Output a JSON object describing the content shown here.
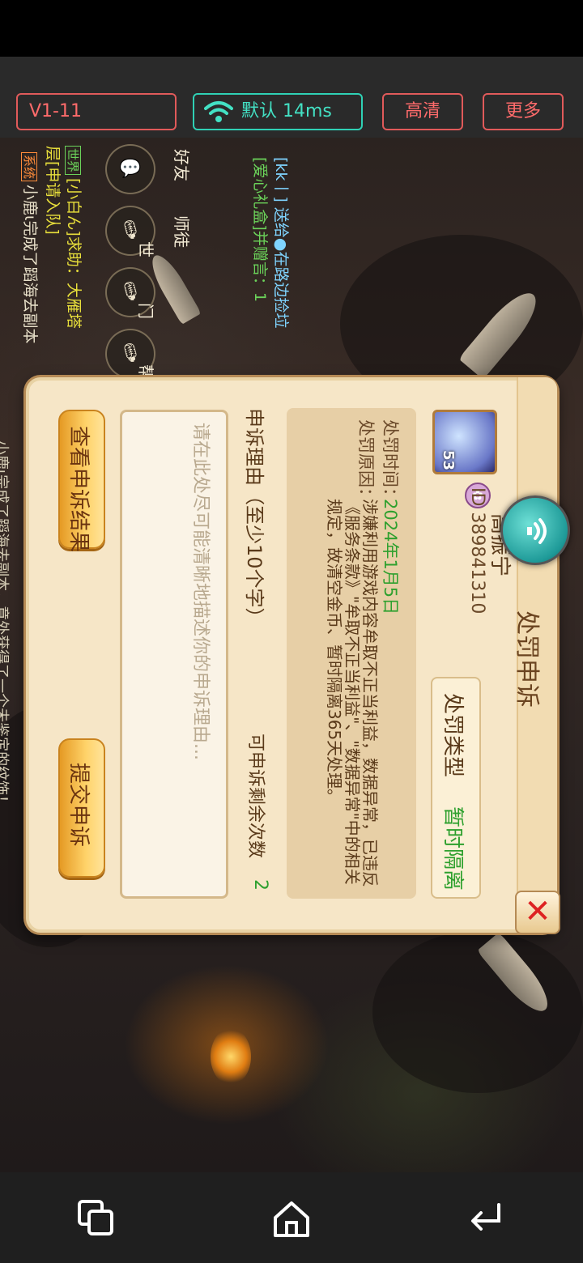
{
  "toolbar": {
    "version": "V1-11",
    "network": "默认 14ms",
    "hd": "高清",
    "more": "更多"
  },
  "game": {
    "chat": {
      "system_tag": "系统",
      "system_line": "小鹿ι完成了蹈海去副本",
      "world_tag": "世界",
      "world_line": "[小白ん]求助：大雁塔",
      "world_line2": "层[申请入队]",
      "gift_line": "[kk丨] 送给●在路边捡垃",
      "gift_line2": "[爱心礼盒]并赠言：1",
      "tail_line": "小鹿ι完成了蹈海去副本，意外获得了一个未鉴定的纹饰！"
    },
    "side": {
      "friends": "好友",
      "master": "师徒",
      "world": "世",
      "team": "门",
      "gang": "帮"
    }
  },
  "dialog": {
    "title": "处罚申诉",
    "player_name": "高振宁",
    "player_id": "ID 389841310",
    "avatar_level": "53",
    "badge_glyph": "✿",
    "punish_type_label": "处罚类型",
    "punish_type_value": "暂时隔离",
    "time_label": "处罚时间：",
    "time_value": "2024年1月5日",
    "reason_label": "处罚原因：",
    "reason_text": "涉嫌利用游戏内容牟取不正当利益，数据异常，已违反《服务条款》\"牟取不正当利益\"、\"数据异常\"中的相关规定，故清空金币、暂时隔离365天处理。",
    "appeal_label": "申诉理由（至少10个字）",
    "remain_label": "可申诉剩余次数",
    "remain_value": "2",
    "placeholder": "请在此处尽可能清晰地描述你的申诉理由...",
    "view_result_button": "查看申诉结果",
    "submit_button": "提交申诉",
    "close_glyph": "✕"
  },
  "colors": {
    "accent_red": "#e05a5a",
    "accent_teal": "#2fd1b5",
    "green_value": "#2ea02e",
    "panel": "#f6e6c7",
    "gold_button": "#ffd36a"
  },
  "icons": {
    "wifi": "wifi-icon",
    "chat": "chat-bubble-icon",
    "mic": "microphone-icon",
    "voice": "voice-icon",
    "close": "close-icon",
    "recent": "recent-apps-icon",
    "home": "home-icon",
    "back": "back-icon"
  }
}
